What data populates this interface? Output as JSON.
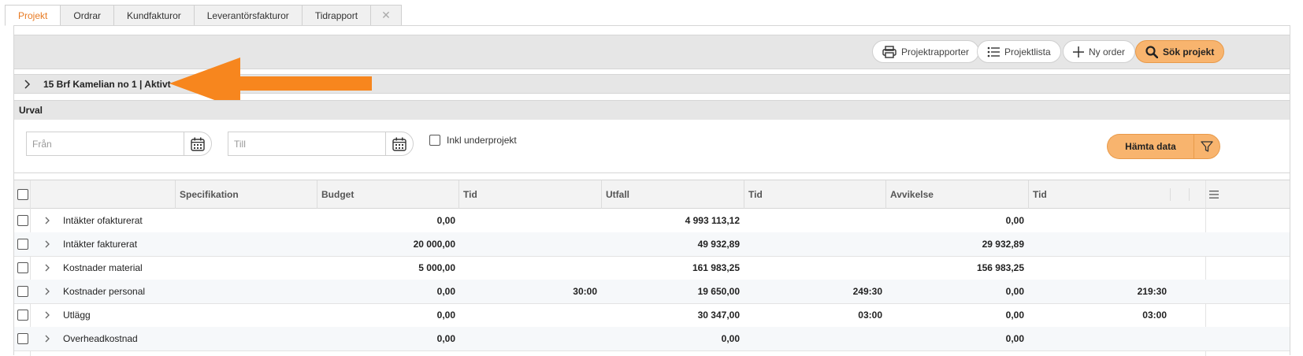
{
  "tabs": [
    {
      "label": "Projekt",
      "active": true
    },
    {
      "label": "Ordrar",
      "active": false
    },
    {
      "label": "Kundfakturor",
      "active": false
    },
    {
      "label": "Leverantörsfakturor",
      "active": false
    },
    {
      "label": "Tidrapport",
      "active": false
    }
  ],
  "tab_close_glyph": "✕",
  "toolbar": {
    "reports_label": "Projektrapporter",
    "list_label": "Projektlista",
    "new_order_label": "Ny order",
    "search_label": "Sök projekt"
  },
  "project": {
    "title": "15 Brf Kamelian no 1 | Aktivt"
  },
  "filter": {
    "heading": "Urval",
    "from_placeholder": "Från",
    "to_placeholder": "Till",
    "include_subprojects_label": "Inkl underprojekt",
    "fetch_label": "Hämta data"
  },
  "table": {
    "columns": [
      "Specifikation",
      "Budget",
      "Tid",
      "Utfall",
      "Tid",
      "Avvikelse",
      "Tid"
    ],
    "rows": [
      {
        "name": "Intäkter ofakturerat",
        "budget": "0,00",
        "budget_tid": "",
        "utfall": "4 993 113,12",
        "utfall_tid": "",
        "avvikelse": "0,00",
        "avvikelse_tid": ""
      },
      {
        "name": "Intäkter fakturerat",
        "budget": "20 000,00",
        "budget_tid": "",
        "utfall": "49 932,89",
        "utfall_tid": "",
        "avvikelse": "29 932,89",
        "avvikelse_tid": ""
      },
      {
        "name": "Kostnader material",
        "budget": "5 000,00",
        "budget_tid": "",
        "utfall": "161 983,25",
        "utfall_tid": "",
        "avvikelse": "156 983,25",
        "avvikelse_tid": ""
      },
      {
        "name": "Kostnader personal",
        "budget": "0,00",
        "budget_tid": "30:00",
        "utfall": "19 650,00",
        "utfall_tid": "249:30",
        "avvikelse": "0,00",
        "avvikelse_tid": "219:30"
      },
      {
        "name": "Utlägg",
        "budget": "0,00",
        "budget_tid": "",
        "utfall": "30 347,00",
        "utfall_tid": "03:00",
        "avvikelse": "0,00",
        "avvikelse_tid": "03:00"
      },
      {
        "name": "Overheadkostnad",
        "budget": "0,00",
        "budget_tid": "",
        "utfall": "0,00",
        "utfall_tid": "",
        "avvikelse": "0,00",
        "avvikelse_tid": ""
      }
    ]
  },
  "icons": {
    "print": "print-icon",
    "list": "list-icon",
    "plus": "plus-icon",
    "search": "search-icon",
    "calendar": "calendar-icon",
    "filter": "filter-icon",
    "expand": "chevron-right-icon",
    "columns_menu": "menu-icon"
  },
  "colors": {
    "accent": "#e87a22",
    "primary_button": "#f8b46e",
    "annotation_arrow": "#f7861e",
    "header_bg": "#e6e6e6"
  }
}
